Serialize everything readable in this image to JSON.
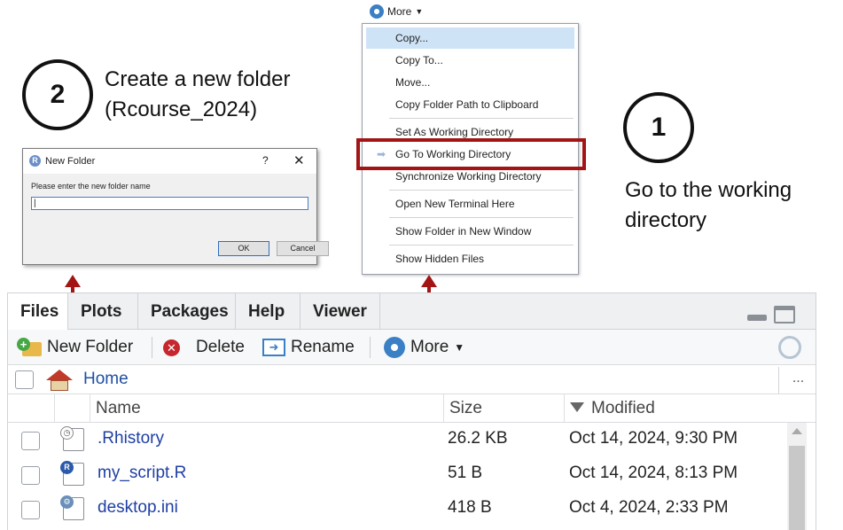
{
  "annotations": {
    "step1_number": "1",
    "step1_text_line1": "Go to the working",
    "step1_text_line2": "directory",
    "step2_number": "2",
    "step2_text_line1": "Create a new folder",
    "step2_text_line2": "(Rcourse_2024)",
    "highlight_color": "#a31515"
  },
  "dialog": {
    "title": "New Folder",
    "help": "?",
    "close": "✕",
    "prompt": "Please enter the new folder name",
    "input_value": "",
    "ok_label": "OK",
    "cancel_label": "Cancel"
  },
  "more_menu": {
    "button_label": "More",
    "items": [
      {
        "label": "Copy...",
        "highlighted": true
      },
      {
        "label": "Copy To..."
      },
      {
        "label": "Move..."
      },
      {
        "label": "Copy Folder Path to Clipboard"
      },
      {
        "label": "Set As Working Directory"
      },
      {
        "label": "Go To Working Directory",
        "boxed": true
      },
      {
        "label": "Synchronize Working Directory"
      },
      {
        "label": "Open New Terminal Here"
      },
      {
        "label": "Show Folder in New Window"
      },
      {
        "label": "Show Hidden Files"
      }
    ]
  },
  "pane": {
    "tabs": [
      "Files",
      "Plots",
      "Packages",
      "Help",
      "Viewer"
    ],
    "active_tab": "Files",
    "toolbar": {
      "new_folder": "New Folder",
      "delete": "Delete",
      "rename": "Rename",
      "more": "More"
    },
    "breadcrumb": {
      "home": "Home",
      "more": "..."
    },
    "columns": {
      "name": "Name",
      "size": "Size",
      "modified": "Modified"
    },
    "files": [
      {
        "name": ".Rhistory",
        "size": "26.2 KB",
        "modified": "Oct 14, 2024, 9:30 PM",
        "icon": "history-file-icon"
      },
      {
        "name": "my_script.R",
        "size": "51 B",
        "modified": "Oct 14, 2024, 8:13 PM",
        "icon": "r-script-icon"
      },
      {
        "name": "desktop.ini",
        "size": "418 B",
        "modified": "Oct 4, 2024, 2:33 PM",
        "icon": "settings-file-icon"
      }
    ]
  }
}
